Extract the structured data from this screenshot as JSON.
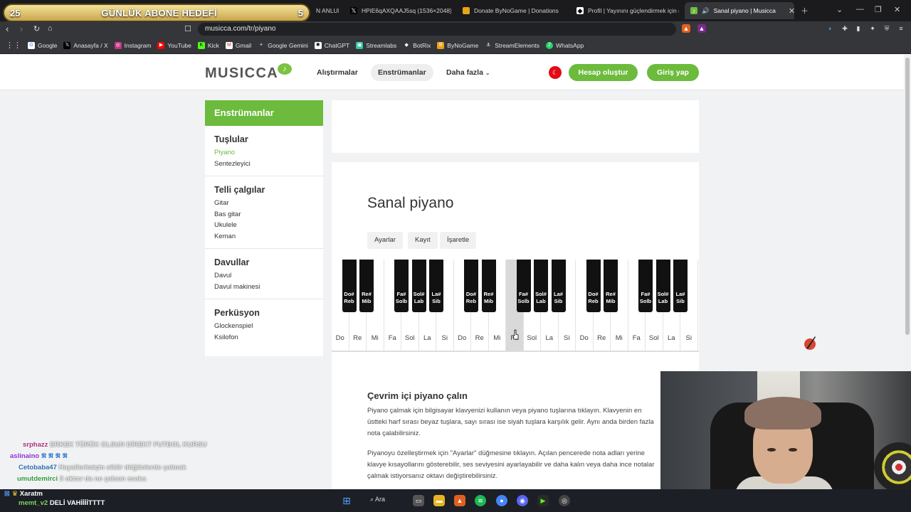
{
  "stream_goal": {
    "left_count": "25",
    "title": "GÜNLÜK ABONE HEDEFİ",
    "right_count": "5"
  },
  "browser": {
    "tabs": [
      {
        "label": "N ANLUK",
        "active": false
      },
      {
        "label": "HPiE6qAXQAAJ5sq (1536×2048)",
        "active": false
      },
      {
        "label": "Donate ByNoGame | Donations",
        "active": false
      },
      {
        "label": "Profil | Yayınını güçlendirmek için en",
        "active": false
      },
      {
        "label": "Sanal piyano | Musicca",
        "active": true
      }
    ],
    "url": "musicca.com/tr/piyano",
    "bookmarks": [
      "Google",
      "Anasayfa / X",
      "Instagram",
      "YouTube",
      "Kick",
      "Gmail",
      "Google Gemini",
      "ChatGPT",
      "Streamlabs",
      "BotRix",
      "ByNoGame",
      "StreamElements",
      "WhatsApp"
    ]
  },
  "site": {
    "logo": "MUSICCA",
    "nav": {
      "exercises": "Alıştırmalar",
      "instruments": "Enstrümanlar",
      "more": "Daha fazla"
    },
    "create_account": "Hesap oluştur",
    "login": "Giriş yap"
  },
  "sidebar": {
    "header": "Enstrümanlar",
    "groups": [
      {
        "title": "Tuşlular",
        "items": [
          "Piyano",
          "Sentezleyici"
        ]
      },
      {
        "title": "Telli çalgılar",
        "items": [
          "Gitar",
          "Bas gitar",
          "Ukulele",
          "Keman"
        ]
      },
      {
        "title": "Davullar",
        "items": [
          "Davul",
          "Davul makinesi"
        ]
      },
      {
        "title": "Perküsyon",
        "items": [
          "Glockenspiel",
          "Ksilofon"
        ]
      }
    ]
  },
  "main": {
    "title": "Sanal piyano",
    "toolbar": {
      "settings": "Ayarlar",
      "record": "Kayıt",
      "mark": "İşaretle"
    },
    "section_title": "Çevrim içi piyano çalın",
    "para1": "Piyano çalmak için bilgisayar klavyenizi kullanın veya piyano tuşlarına tıklayın. Klavyenin en üstteki harf sırası beyaz tuşlara, sayı sırası ise siyah tuşlara karşılık gelir. Aynı anda birden fazla nota çalabilirsiniz.",
    "para2": "Piyanoyu özelleştirmek için \"Ayarlar\" düğmesine tıklayın. Açılan pencerede nota adları yerine klavye kısayollarını gösterebilir, ses seviyesini ayarlayabilir ve daha kalın veya daha ince notalar çalmak istiyorsanız oktavı değiştirebilirsiniz."
  },
  "piano": {
    "white_keys": [
      "Do",
      "Re",
      "Mi",
      "Fa",
      "Sol",
      "La",
      "Si",
      "Do",
      "Re",
      "Mi",
      "Fa",
      "Sol",
      "La",
      "Si",
      "Do",
      "Re",
      "Mi",
      "Fa",
      "Sol",
      "La",
      "Si"
    ],
    "pressed_index": 10,
    "black_keys": [
      {
        "after": 0,
        "label": "Do#\nReb"
      },
      {
        "after": 1,
        "label": "Re#\nMib"
      },
      {
        "after": 3,
        "label": "Fa#\nSolb"
      },
      {
        "after": 4,
        "label": "Sol#\nLab"
      },
      {
        "after": 5,
        "label": "La#\nSib"
      },
      {
        "after": 7,
        "label": "Do#\nReb"
      },
      {
        "after": 8,
        "label": "Re#\nMib"
      },
      {
        "after": 10,
        "label": "Fa#\nSolb"
      },
      {
        "after": 11,
        "label": "Sol#\nLab"
      },
      {
        "after": 12,
        "label": "La#\nSib"
      },
      {
        "after": 14,
        "label": "Do#\nReb"
      },
      {
        "after": 15,
        "label": "Re#\nMib"
      },
      {
        "after": 17,
        "label": "Fa#\nSolb"
      },
      {
        "after": 18,
        "label": "Sol#\nLab"
      },
      {
        "after": 19,
        "label": "La#\nSib"
      }
    ]
  },
  "chat": [
    {
      "user": "srphazz",
      "color": "#a8307a",
      "msg": "ERKEK TÜRÜK OLSUN DİREKT FUTBOL KURSU"
    },
    {
      "user": "aslinaino",
      "color": "#8b2fd1",
      "msg": ""
    },
    {
      "user": "Cetobaba47",
      "color": "#2a6fb0",
      "msg": "Hayallerimiçin siktir düğünlerde çalmak"
    },
    {
      "user": "umutdemirci",
      "color": "#2f9a3b",
      "msg": "3 oktav da ne çalsan ssaka"
    },
    {
      "user": "Xaratm",
      "color": "#ffffff",
      "msg": ""
    },
    {
      "user": "memt_v2",
      "color": "#7cd35f",
      "msg": "DELİ VAHİİİİTTTT"
    }
  ],
  "taskbar": {
    "search": "Ara"
  }
}
